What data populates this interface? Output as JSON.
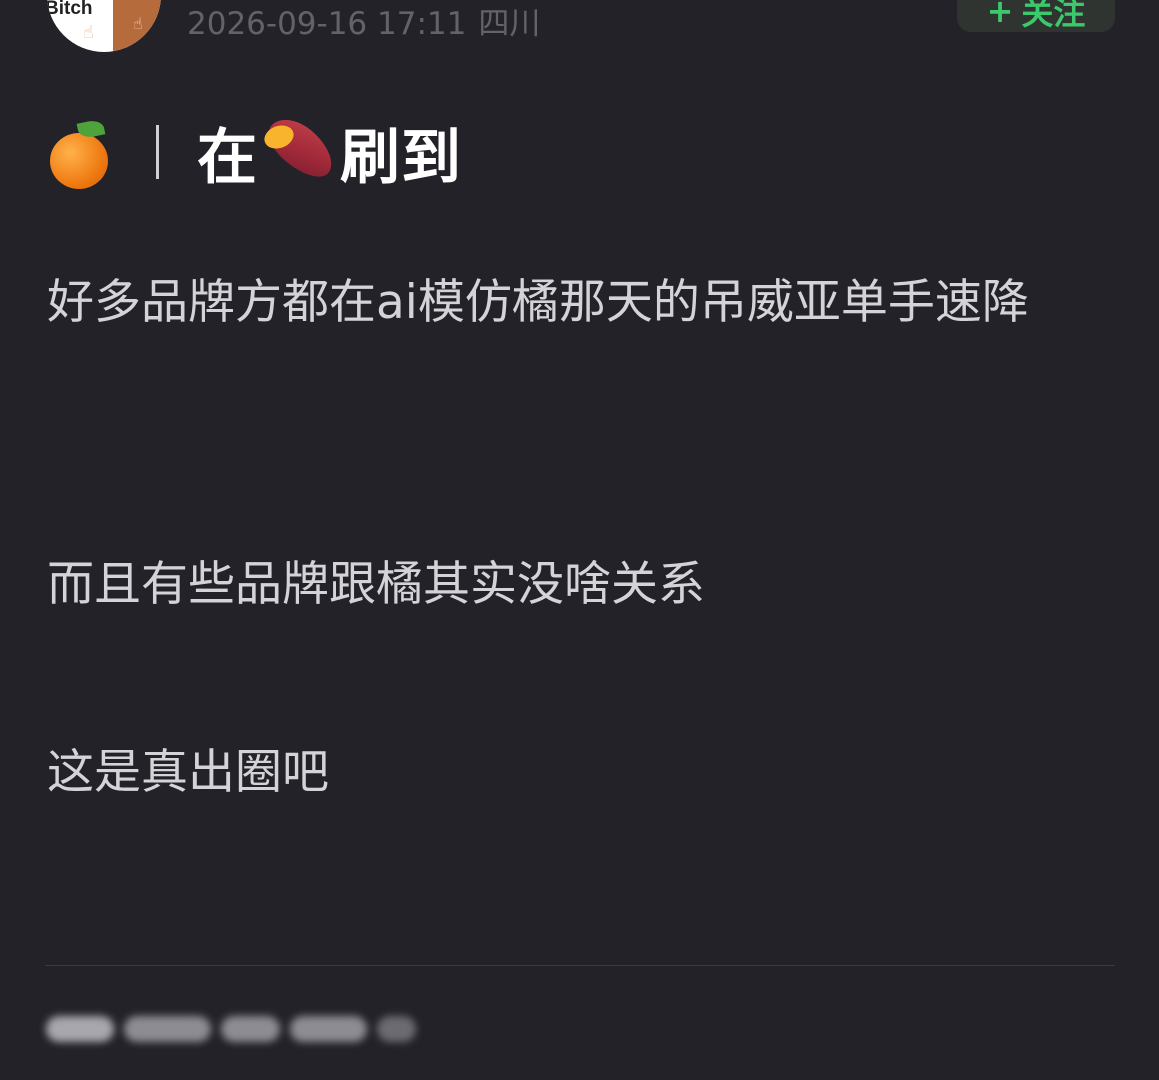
{
  "header": {
    "avatar_text": "Bitch",
    "timestamp": "2026-09-16 17:11",
    "location": "四川",
    "follow_button": {
      "plus": "+",
      "label": "关注"
    }
  },
  "post": {
    "title": {
      "orange_emoji": "orange-emoji",
      "text_before": "在",
      "sweetpotato_emoji": "sweet-potato-emoji",
      "text_after": "刷到"
    },
    "paragraphs": [
      "好多品牌方都在ai模仿橘那天的吊威亚单手速降",
      "而且有些品牌跟橘其实没啥关系",
      "这是真出圈吧"
    ]
  },
  "colors": {
    "background": "#232228",
    "text": "#d4d4d8",
    "meta": "#636268",
    "follow_accent": "#3cc86c"
  }
}
